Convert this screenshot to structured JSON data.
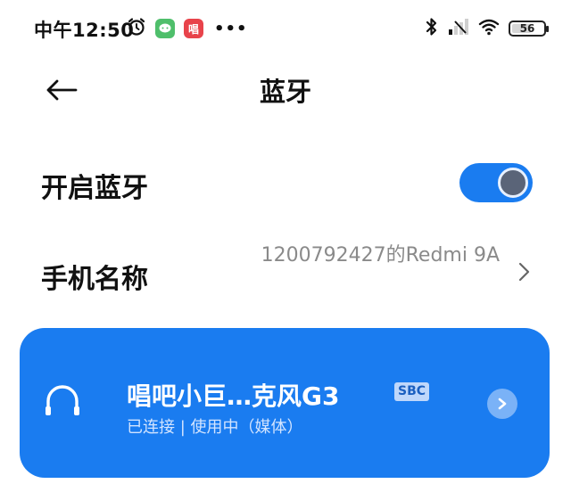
{
  "status_bar": {
    "time": "中午12:50",
    "app_icon_label": "唱",
    "more": "•••",
    "battery_level": "56"
  },
  "header": {
    "title": "蓝牙"
  },
  "settings": {
    "bluetooth_label": "开启蓝牙",
    "bluetooth_enabled": true,
    "device_name_label": "手机名称",
    "device_name_value": "1200792427的Redmi 9A"
  },
  "connected_device": {
    "name": "唱吧小巨…克风G3",
    "codec": "SBC",
    "status": "已连接 | 使用中（媒体）"
  },
  "colors": {
    "accent": "#1a7cf0"
  }
}
